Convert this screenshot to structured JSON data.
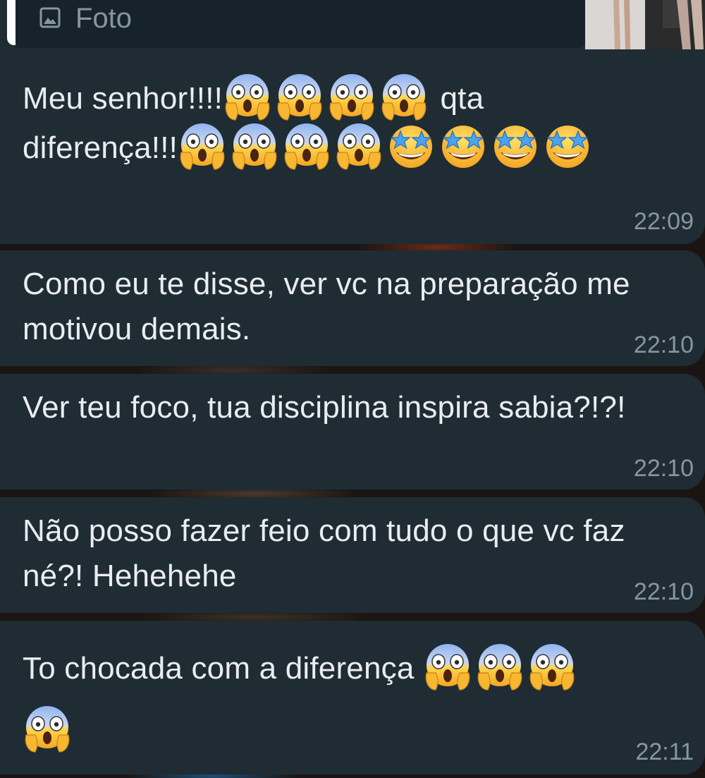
{
  "reply_preview": {
    "label": "Foto",
    "icon": "photo-icon"
  },
  "messages": [
    {
      "text_a": "Meu senhor!!!!",
      "emojis_a": [
        "face-screaming-in-fear",
        "face-screaming-in-fear",
        "face-screaming-in-fear",
        "face-screaming-in-fear"
      ],
      "text_b": " qta",
      "text_c": "diferença!!!",
      "emojis_c": [
        "face-screaming-in-fear",
        "face-screaming-in-fear",
        "face-screaming-in-fear",
        "face-screaming-in-fear",
        "star-struck",
        "star-struck",
        "star-struck",
        "star-struck"
      ],
      "time": "22:09"
    },
    {
      "text": "Como eu te disse, ver vc na preparação me motivou demais.",
      "time": "22:10"
    },
    {
      "text": "Ver teu foco, tua disciplina inspira sabia?!?!",
      "time": "22:10"
    },
    {
      "text": "Não posso fazer feio com tudo o que vc faz né?! Hehehehe",
      "time": "22:10"
    },
    {
      "text": "To chocada com a diferença ",
      "emojis": [
        "face-screaming-in-fear",
        "face-screaming-in-fear",
        "face-screaming-in-fear",
        "face-screaming-in-fear"
      ],
      "time": "22:11"
    }
  ],
  "colors": {
    "bubble": "#1f2c34",
    "text": "#e9edef",
    "meta": "#8696a0"
  }
}
